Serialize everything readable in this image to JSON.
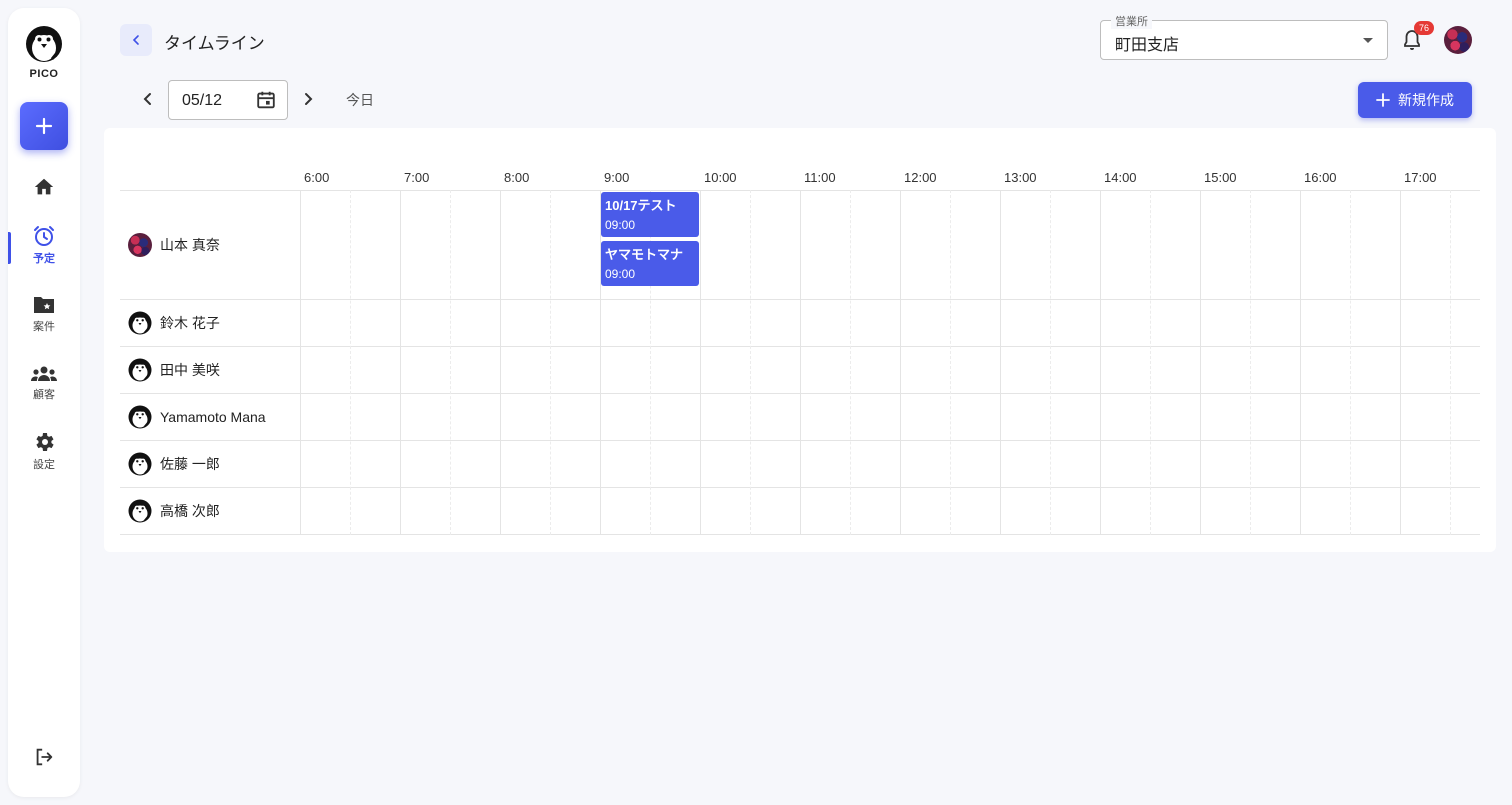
{
  "brand": {
    "name": "PICO"
  },
  "sidebar": {
    "items": [
      {
        "label": "",
        "icon": "home-icon"
      },
      {
        "label": "予定",
        "icon": "alarm-clock-icon",
        "active": true
      },
      {
        "label": "案件",
        "icon": "folder-star-icon"
      },
      {
        "label": "顧客",
        "icon": "group-icon"
      },
      {
        "label": "設定",
        "icon": "gear-icon"
      }
    ]
  },
  "header": {
    "title": "タイムライン",
    "branch": {
      "label": "営業所",
      "value": "町田支店"
    },
    "notifications": {
      "count": "76"
    }
  },
  "date_nav": {
    "date": "05/12",
    "today_label": "今日"
  },
  "actions": {
    "new_label": "新規作成"
  },
  "timeline": {
    "hours": [
      "6:00",
      "7:00",
      "8:00",
      "9:00",
      "10:00",
      "11:00",
      "12:00",
      "13:00",
      "14:00",
      "15:00",
      "16:00",
      "17:00"
    ],
    "people": [
      {
        "name": "山本 真奈",
        "avatar": "photo"
      },
      {
        "name": "鈴木 花子",
        "avatar": "penguin"
      },
      {
        "name": "田中 美咲",
        "avatar": "penguin"
      },
      {
        "name": "Yamamoto Mana",
        "avatar": "penguin"
      },
      {
        "name": "佐藤 一郎",
        "avatar": "penguin"
      },
      {
        "name": "高橋 次郎",
        "avatar": "penguin"
      }
    ],
    "events": [
      {
        "person": "山本 真奈",
        "title": "10/17テスト",
        "time": "09:00"
      },
      {
        "person": "山本 真奈",
        "title": "ヤマモトマナ",
        "time": "09:00"
      }
    ]
  },
  "colors": {
    "accent": "#4a5be9",
    "badge": "#e53935",
    "background": "#f6f7fb"
  }
}
